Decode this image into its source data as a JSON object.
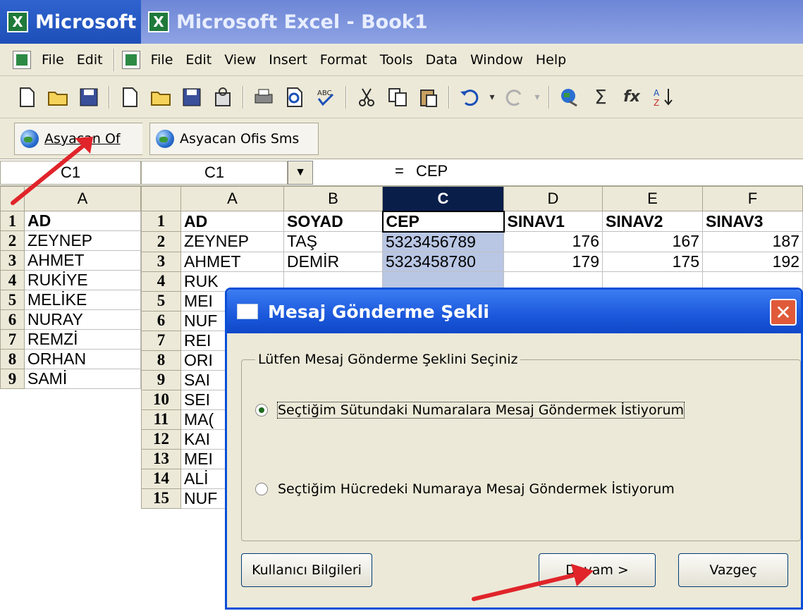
{
  "left_window": {
    "title": "Microsoft",
    "menu": [
      "File",
      "Edit"
    ],
    "addin_button": "Asyacan Of",
    "namebox": "C1",
    "col_header": "A",
    "rows": [
      {
        "n": "1",
        "a": "AD"
      },
      {
        "n": "2",
        "a": "ZEYNEP"
      },
      {
        "n": "3",
        "a": "AHMET"
      },
      {
        "n": "4",
        "a": "RUKİYE"
      },
      {
        "n": "5",
        "a": "MELİKE"
      },
      {
        "n": "6",
        "a": "NURAY"
      },
      {
        "n": "7",
        "a": "REMZİ"
      },
      {
        "n": "8",
        "a": "ORHAN"
      },
      {
        "n": "9",
        "a": "SAMİ"
      }
    ]
  },
  "right_window": {
    "title": "Microsoft Excel - Book1",
    "menu": [
      "File",
      "Edit",
      "View",
      "Insert",
      "Format",
      "Tools",
      "Data",
      "Window",
      "Help"
    ],
    "addin_button": "Asyacan Ofis Sms",
    "namebox": "C1",
    "formula_eq": "=",
    "formula_value": "CEP",
    "col_headers": [
      "A",
      "B",
      "C",
      "D",
      "E",
      "F"
    ],
    "rows": [
      {
        "n": "1",
        "a": "AD",
        "b": "SOYAD",
        "c": "CEP",
        "d": "SINAV1",
        "e": "SINAV2",
        "f": "SINAV3"
      },
      {
        "n": "2",
        "a": "ZEYNEP",
        "b": "TAŞ",
        "c": "5323456789",
        "d": "176",
        "e": "167",
        "f": "187"
      },
      {
        "n": "3",
        "a": "AHMET",
        "b": "DEMİR",
        "c": "5323458780",
        "d": "179",
        "e": "175",
        "f": "192"
      },
      {
        "n": "4",
        "a": "RUK"
      },
      {
        "n": "5",
        "a": "MEI"
      },
      {
        "n": "6",
        "a": "NUF"
      },
      {
        "n": "7",
        "a": "REI"
      },
      {
        "n": "8",
        "a": "ORI"
      },
      {
        "n": "9",
        "a": "SAI"
      },
      {
        "n": "10",
        "a": "SEI"
      },
      {
        "n": "11",
        "a": "MA("
      },
      {
        "n": "12",
        "a": "KAI"
      },
      {
        "n": "13",
        "a": "MEI"
      },
      {
        "n": "14",
        "a": "ALİ"
      },
      {
        "n": "15",
        "a": "NUF"
      }
    ]
  },
  "dialog": {
    "title": "Mesaj Gönderme Şekli",
    "close_label": "✕",
    "group_label": "Lütfen Mesaj Gönderme Şeklini Seçiniz",
    "option1": "Seçtiğim Sütundaki Numaralara Mesaj Göndermek İstiyorum",
    "option2": "Seçtiğim Hücredeki Numaraya Mesaj Göndermek İstiyorum",
    "btn_user": "Kullanıcı Bilgileri",
    "btn_next": "Devam >",
    "btn_cancel": "Vazgeç"
  },
  "colors": {
    "title_active": "#1e4fb8",
    "title_inactive": "#8ea3e4",
    "annotation_arrow": "#e0242a"
  }
}
